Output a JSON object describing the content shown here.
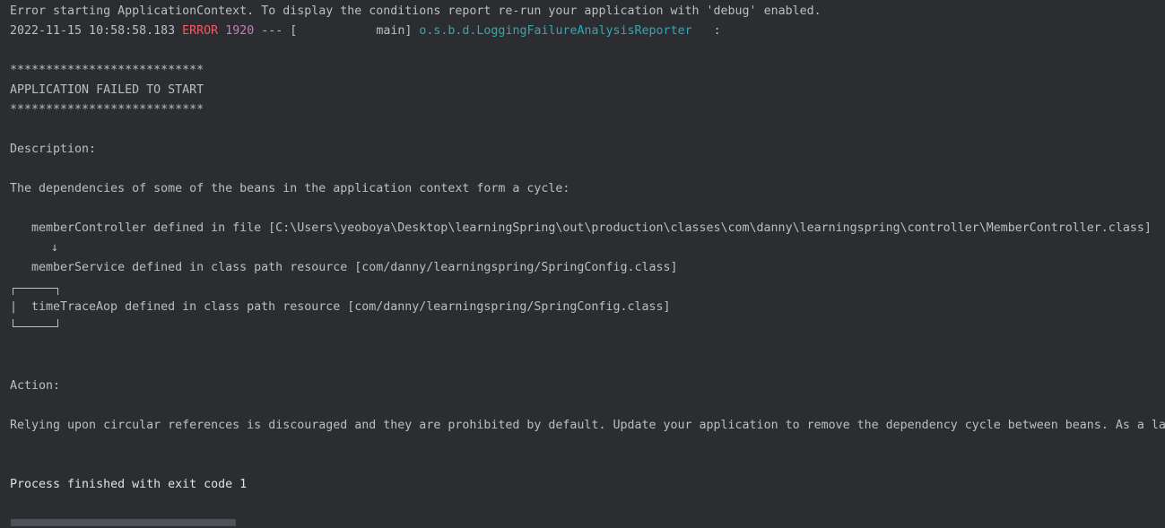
{
  "console": {
    "line1": "Error starting ApplicationContext. To display the conditions report re-run your application with 'debug' enabled.",
    "log": {
      "timestamp": "2022-11-15 10:58:58.183",
      "level": "ERROR",
      "pid": "1920",
      "separator": "--- [           main]",
      "logger": "o.s.b.d.LoggingFailureAnalysisReporter",
      "colon": ":"
    },
    "stars1": "***************************",
    "failed": "APPLICATION FAILED TO START",
    "stars2": "***************************",
    "description_label": "Description:",
    "description_text": "The dependencies of some of the beans in the application context form a cycle:",
    "bean1": "memberController defined in file [C:\\Users\\yeoboya\\Desktop\\learningSpring\\out\\production\\classes\\com\\danny\\learningspring\\controller\\MemberController.class]",
    "arrow": "↓",
    "bean2": "memberService defined in class path resource [com/danny/learningspring/SpringConfig.class]",
    "cycle_bar": "|",
    "bean3": "timeTraceAop defined in class path resource [com/danny/learningspring/SpringConfig.class]",
    "action_label": "Action:",
    "action_text": "Relying upon circular references is discouraged and they are prohibited by default. Update your application to remove the dependency cycle between beans. As a la",
    "exit_text": "Process finished with exit code 1"
  }
}
